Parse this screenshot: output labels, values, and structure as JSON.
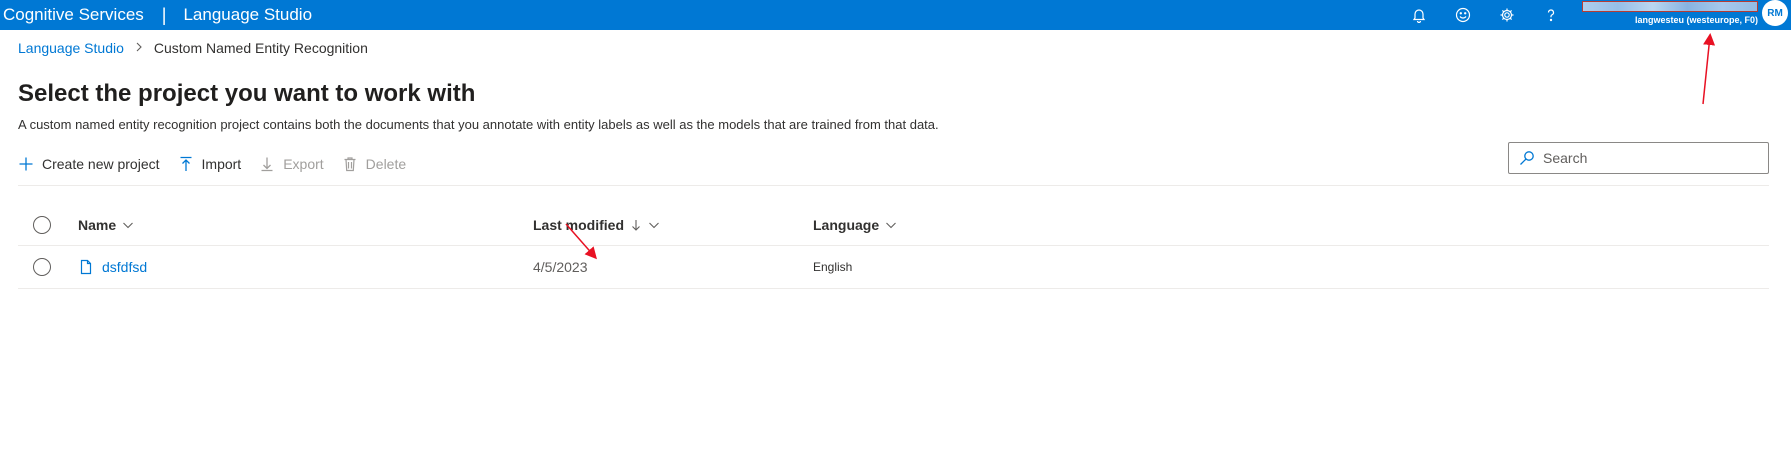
{
  "header": {
    "brand": "Cognitive Services",
    "separator": "|",
    "product": "Language Studio",
    "account_subtitle": "langwesteu (westeurope, F0)",
    "avatar_initials": "RM",
    "icons": [
      "bell-icon",
      "smiley-feedback-icon",
      "gear-icon",
      "help-icon"
    ]
  },
  "breadcrumb": {
    "root": "Language Studio",
    "current": "Custom Named Entity Recognition"
  },
  "page": {
    "title": "Select the project you want to work with",
    "description": "A custom named entity recognition project contains both the documents that you annotate with entity labels as well as the models that are trained from that data."
  },
  "toolbar": {
    "create": "Create new project",
    "import": "Import",
    "export": "Export",
    "delete": "Delete"
  },
  "search": {
    "placeholder": "Search"
  },
  "table": {
    "columns": {
      "name": "Name",
      "last_modified": "Last modified",
      "language": "Language"
    },
    "rows": [
      {
        "name": "dsfdfsd",
        "last_modified": "4/5/2023",
        "language": "English"
      }
    ]
  },
  "colors": {
    "accent": "#0078d4",
    "annotation": "#e81123"
  }
}
